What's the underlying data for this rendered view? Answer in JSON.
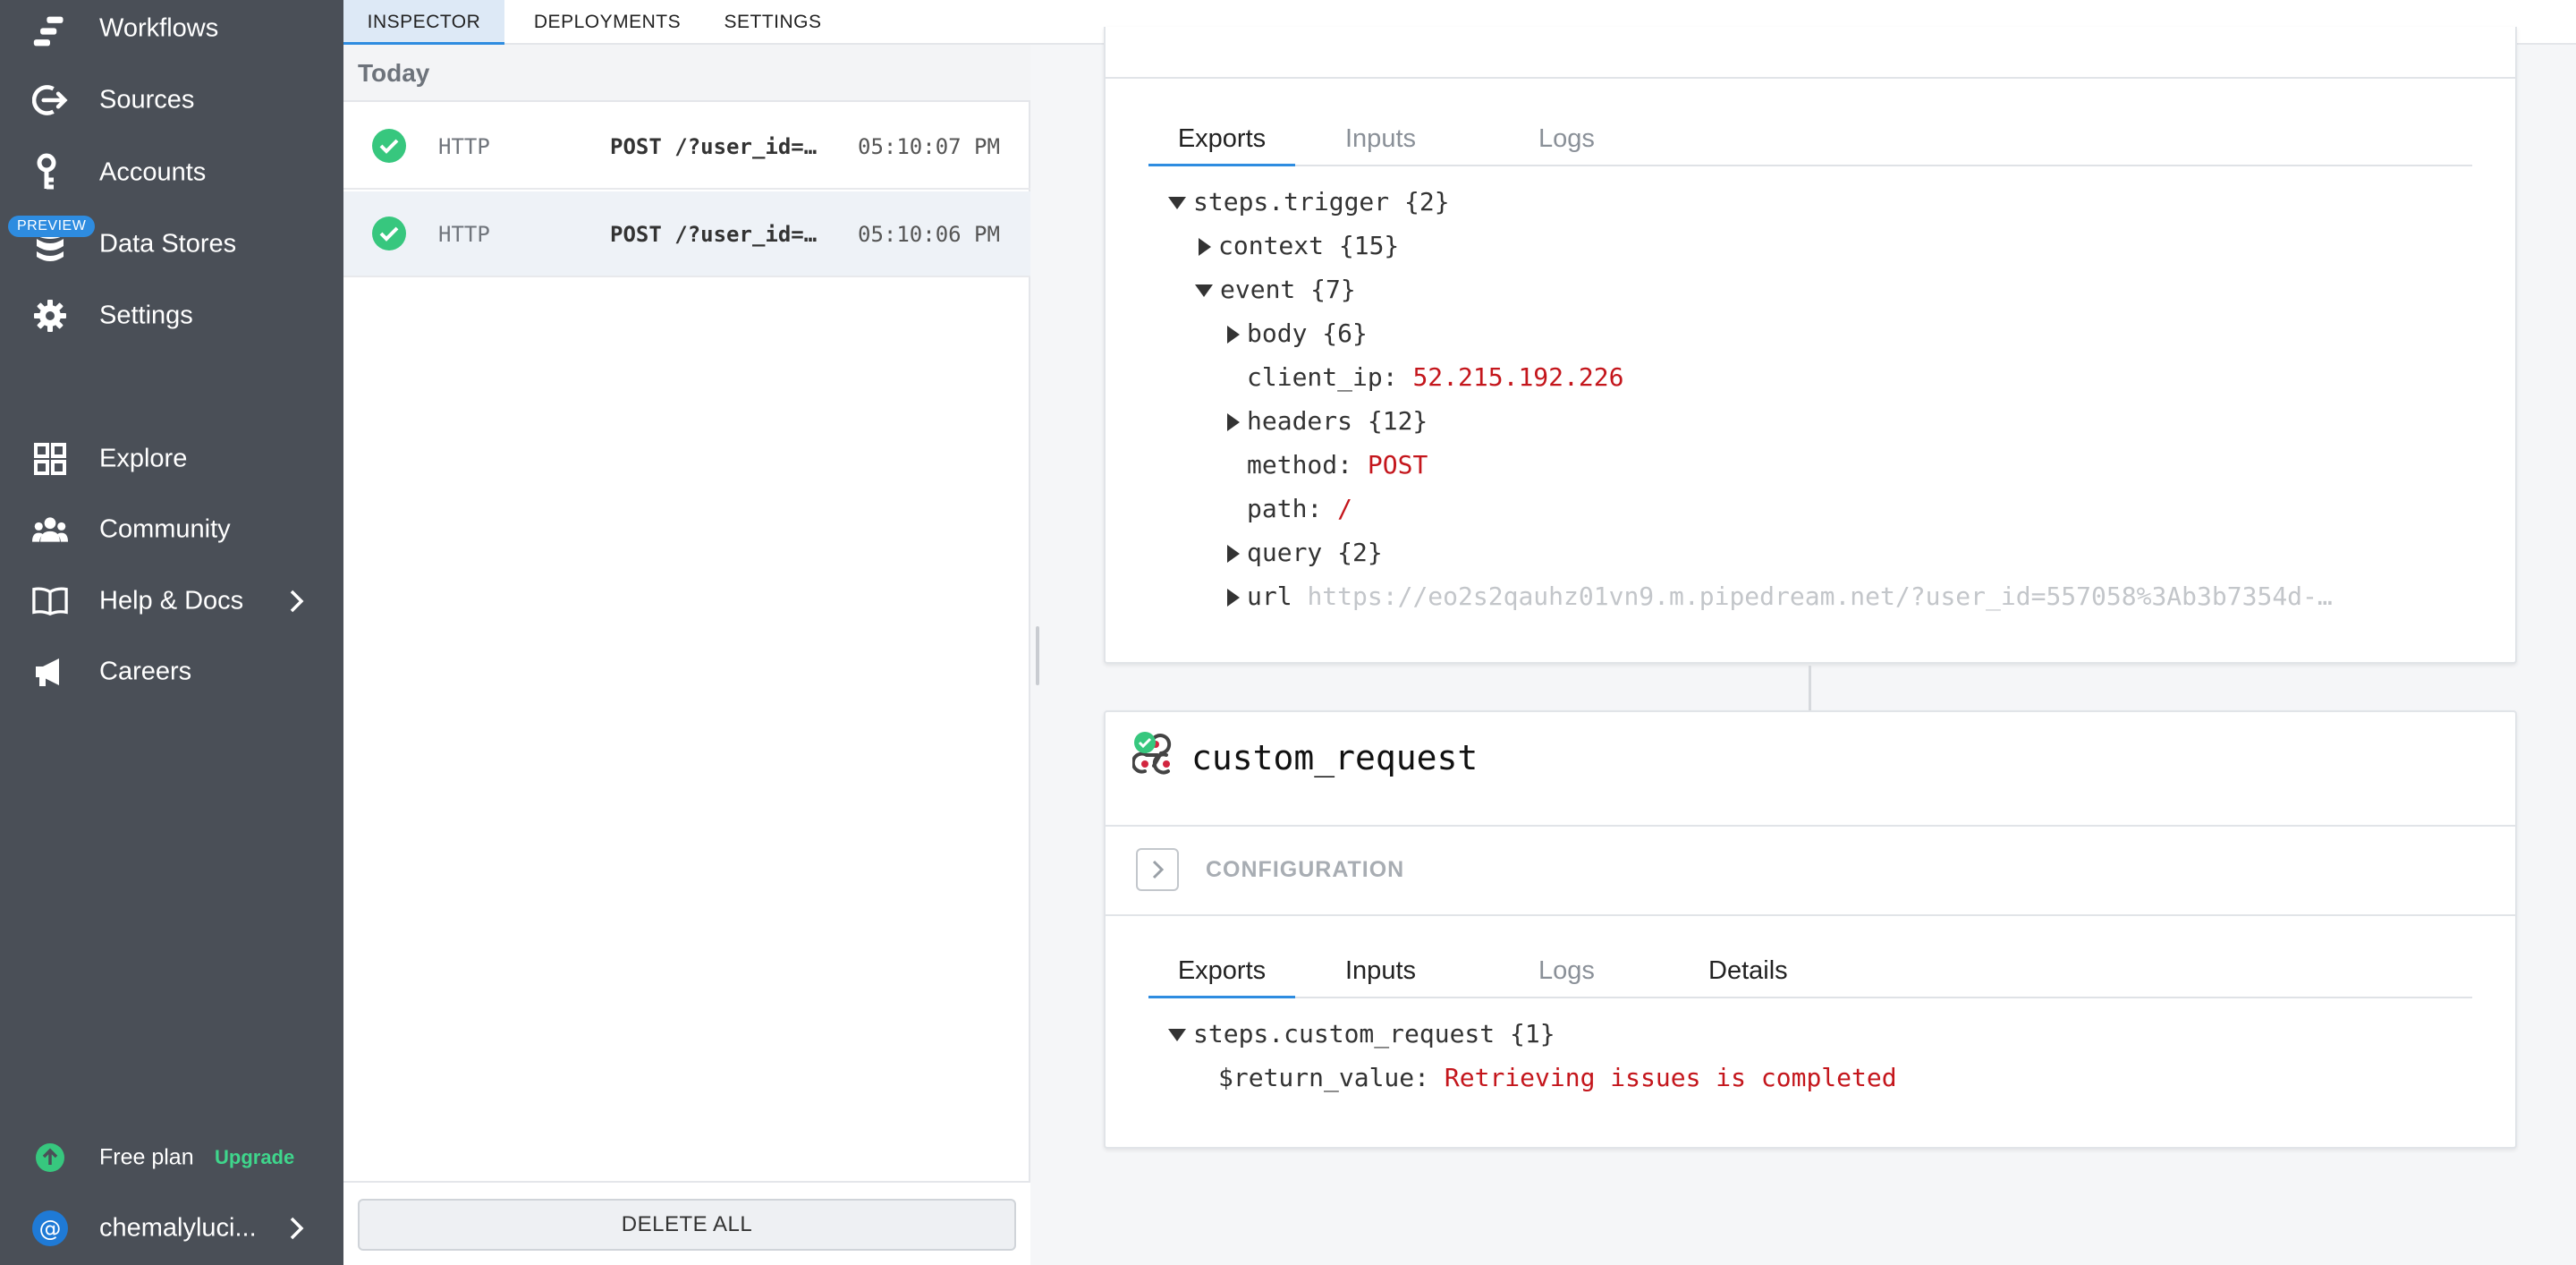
{
  "sidebar": {
    "items": [
      {
        "label": "Workflows",
        "icon": "workflows-icon"
      },
      {
        "label": "Sources",
        "icon": "sources-icon"
      },
      {
        "label": "Accounts",
        "icon": "key-icon"
      },
      {
        "label": "Data Stores",
        "icon": "database-icon",
        "badge": "PREVIEW"
      },
      {
        "label": "Settings",
        "icon": "gear-icon"
      },
      {
        "label": "Explore",
        "icon": "grid-icon"
      },
      {
        "label": "Community",
        "icon": "people-icon"
      },
      {
        "label": "Help & Docs",
        "icon": "book-icon"
      },
      {
        "label": "Careers",
        "icon": "megaphone-icon"
      }
    ],
    "plan": {
      "label": "Free plan",
      "upgrade": "Upgrade"
    },
    "user": {
      "name": "chemalyluci..."
    }
  },
  "top_tabs": [
    "INSPECTOR",
    "DEPLOYMENTS",
    "SETTINGS"
  ],
  "event_list": {
    "day_header": "Today",
    "events": [
      {
        "source": "HTTP",
        "path": "POST /?user_id=…",
        "time": "05:10:07 PM"
      },
      {
        "source": "HTTP",
        "path": "POST /?user_id=…",
        "time": "05:10:06 PM"
      }
    ],
    "delete_all": "DELETE ALL"
  },
  "trigger_step": {
    "tabs": [
      "Exports",
      "Inputs",
      "Logs"
    ],
    "root": "steps.trigger {2}",
    "context": "context {15}",
    "event": "event {7}",
    "body": "body {6}",
    "client_ip_key": "client_ip:",
    "client_ip_val": "52.215.192.226",
    "headers": "headers {12}",
    "method_key": "method:",
    "method_val": "POST",
    "path_key": "path:",
    "path_val": "/",
    "query": "query {2}",
    "url_key": "url",
    "url_val": "https://eo2s2qauhz01vn9.m.pipedream.net/?user_id=557058%3Ab3b7354d-…"
  },
  "custom_step": {
    "title": "custom_request",
    "configuration": "CONFIGURATION",
    "tabs": [
      "Exports",
      "Inputs",
      "Logs",
      "Details"
    ],
    "root": "steps.custom_request {1}",
    "return_key": "$return_value:",
    "return_val": "Retrieving issues is completed"
  },
  "colors": {
    "sidebar_bg": "#4a4f57",
    "accent": "#2e8ce0",
    "success": "#37c77e",
    "value_red": "#c4161c"
  }
}
